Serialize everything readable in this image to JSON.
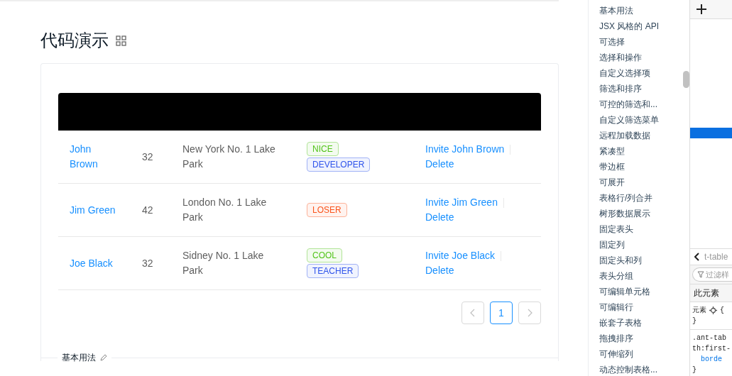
{
  "demo": {
    "title": "代码演示",
    "table": {
      "rows": [
        {
          "name": "John Brown",
          "age": "32",
          "address": "New York No. 1 Lake Park",
          "tags": [
            {
              "label": "NICE",
              "color": "#52c41a"
            },
            {
              "label": "DEVELOPER",
              "color": "#2f54eb"
            }
          ],
          "invite": "Invite John Brown",
          "delete": "Delete"
        },
        {
          "name": "Jim Green",
          "age": "42",
          "address": "London No. 1 Lake Park",
          "tags": [
            {
              "label": "LOSER",
              "color": "#fa541c"
            }
          ],
          "invite": "Invite Jim Green",
          "delete": "Delete"
        },
        {
          "name": "Joe Black",
          "age": "32",
          "address": "Sidney No. 1 Lake Park",
          "tags": [
            {
              "label": "COOL",
              "color": "#52c41a"
            },
            {
              "label": "TEACHER",
              "color": "#2f54eb"
            }
          ],
          "invite": "Invite Joe Black",
          "delete": "Delete"
        }
      ]
    },
    "pagination": {
      "prev_disabled": true,
      "pages": [
        {
          "label": "1",
          "selected": true
        }
      ],
      "next_disabled": true
    },
    "next_section_title": "基本用法"
  },
  "anchor_nav": {
    "items": [
      "基本用法",
      "JSX 风格的 API",
      "可选择",
      "选择和操作",
      "自定义选择项",
      "筛选和排序",
      "可控的筛选和...",
      "自定义筛选菜单",
      "远程加载数据",
      "紧凑型",
      "带边框",
      "可展开",
      "表格行/列合并",
      "树形数据展示",
      "固定表头",
      "固定列",
      "固定头和列",
      "表头分组",
      "可编辑单元格",
      "可编辑行",
      "嵌套子表格",
      "拖拽排序",
      "可伸缩列",
      "动态控制表格..."
    ]
  },
  "devtools": {
    "breadcrumb": "t-table",
    "filter": {
      "placeholder": "过滤样"
    },
    "section_title": "此元素",
    "rules": [
      {
        "kind": "element",
        "selector": "元素",
        "open": "{",
        "close": "}"
      },
      {
        "kind": "class",
        "selector_lines": [
          ".ant-tab",
          "th:first-"
        ],
        "property": "borde",
        "close": "}"
      }
    ]
  }
}
